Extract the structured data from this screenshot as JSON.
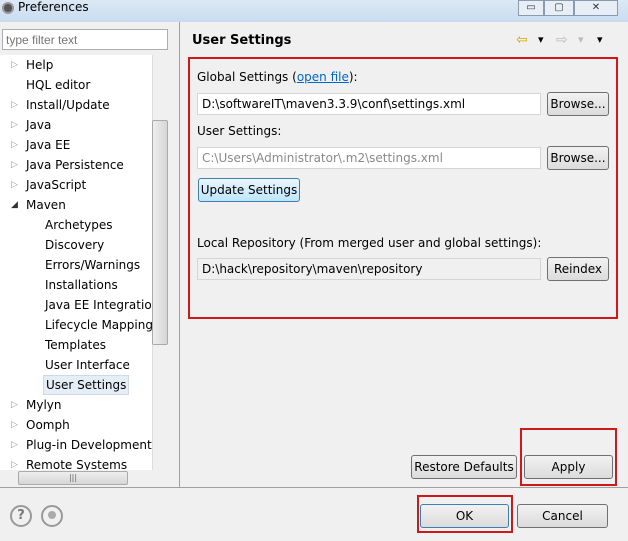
{
  "window": {
    "title": "Preferences",
    "controls": [
      "▭",
      "▢",
      "✕"
    ]
  },
  "filter": {
    "placeholder": "type filter text"
  },
  "tree": {
    "items": [
      {
        "label": "Help",
        "expander": "▷",
        "level": 0
      },
      {
        "label": "HQL editor",
        "expander": "",
        "level": 0
      },
      {
        "label": "Install/Update",
        "expander": "▷",
        "level": 0
      },
      {
        "label": "Java",
        "expander": "▷",
        "level": 0
      },
      {
        "label": "Java EE",
        "expander": "▷",
        "level": 0
      },
      {
        "label": "Java Persistence",
        "expander": "▷",
        "level": 0
      },
      {
        "label": "JavaScript",
        "expander": "▷",
        "level": 0
      },
      {
        "label": "Maven",
        "expander": "◢",
        "level": 0
      },
      {
        "label": "Archetypes",
        "expander": "",
        "level": 1
      },
      {
        "label": "Discovery",
        "expander": "",
        "level": 1
      },
      {
        "label": "Errors/Warnings",
        "expander": "",
        "level": 1
      },
      {
        "label": "Installations",
        "expander": "",
        "level": 1
      },
      {
        "label": "Java EE Integration",
        "expander": "",
        "level": 1
      },
      {
        "label": "Lifecycle Mapping",
        "expander": "",
        "level": 1
      },
      {
        "label": "Templates",
        "expander": "",
        "level": 1
      },
      {
        "label": "User Interface",
        "expander": "",
        "level": 1
      },
      {
        "label": "User Settings",
        "expander": "",
        "level": 1,
        "selected": true
      },
      {
        "label": "Mylyn",
        "expander": "▷",
        "level": 0
      },
      {
        "label": "Oomph",
        "expander": "▷",
        "level": 0
      },
      {
        "label": "Plug-in Development",
        "expander": "▷",
        "level": 0
      },
      {
        "label": "Remote Systems",
        "expander": "▷",
        "level": 0
      }
    ]
  },
  "page": {
    "title": "User Settings",
    "nav": {
      "back": "⇦",
      "fwd": "⇨",
      "menu": "▾"
    },
    "global_label_pre": "Global Settings (",
    "global_link": "open file",
    "global_label_post": "):",
    "global_value": "D:\\softwareIT\\maven3.3.9\\conf\\settings.xml",
    "browse": "Browse...",
    "user_label": "User Settings:",
    "user_value": "C:\\Users\\Administrator\\.m2\\settings.xml",
    "update": "Update Settings",
    "local_label": "Local Repository (From merged user and global settings):",
    "local_value": "D:\\hack\\repository\\maven\\repository",
    "reindex": "Reindex",
    "restore": "Restore Defaults",
    "apply": "Apply"
  },
  "footer": {
    "ok": "OK",
    "cancel": "Cancel",
    "help": "?"
  },
  "colors": {
    "highlight": "#d01818",
    "link": "#0066cc"
  }
}
